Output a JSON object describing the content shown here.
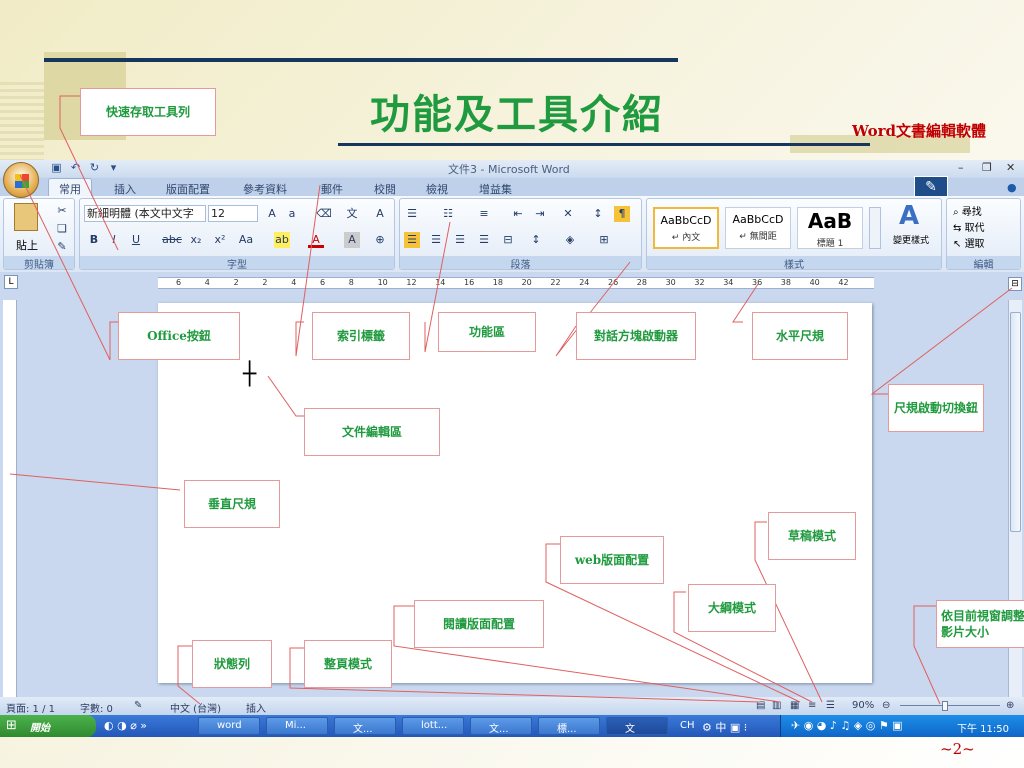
{
  "slide": {
    "title": "功能及工具介紹",
    "subtitle": "Word文書編輯軟體",
    "page_number": "~2~"
  },
  "window": {
    "title": "文件3 - Microsoft Word",
    "qat_icons": [
      "save-icon",
      "undo-icon",
      "redo-icon",
      "customize-icon"
    ]
  },
  "tabs": [
    "常用",
    "插入",
    "版面配置",
    "參考資料",
    "郵件",
    "校閱",
    "檢視",
    "增益集"
  ],
  "ribbon": {
    "clipboard": {
      "label": "剪貼簿",
      "paste": "貼上"
    },
    "font": {
      "label": "字型",
      "name": "新細明體 (本文中文字",
      "size": "12"
    },
    "paragraph": {
      "label": "段落"
    },
    "styles": {
      "label": "樣式",
      "items": [
        {
          "preview": "AaBbCcD",
          "name": "↵ 內文"
        },
        {
          "preview": "AaBbCcD",
          "name": "↵ 無間距"
        },
        {
          "preview": "AaB",
          "name": "標題 1"
        }
      ],
      "change_styles": "變更樣式"
    },
    "editing": {
      "label": "編輯",
      "find": "尋找",
      "replace": "取代",
      "select": "選取"
    }
  },
  "ruler_ticks": [
    "6",
    "4",
    "2",
    "2",
    "4",
    "6",
    "8",
    "10",
    "12",
    "14",
    "16",
    "18",
    "20",
    "22",
    "24",
    "26",
    "28",
    "30",
    "32",
    "34",
    "36",
    "38",
    "40",
    "42"
  ],
  "status": {
    "page": "頁面: 1 / 1",
    "words": "字數: 0",
    "language": "中文 (台灣)",
    "mode": "插入",
    "zoom": "90%"
  },
  "taskbar": {
    "start": "開始",
    "buttons": [
      "word",
      "Mi...",
      "文...",
      "lott...",
      "文...",
      "標...",
      "文"
    ],
    "clock": "下午 11:50",
    "ime": "CH"
  },
  "callouts": {
    "qat": "快速存取工具列",
    "office": "Office按鈕",
    "tab": "索引標籤",
    "ribbon": "功能區",
    "dialog": "對話方塊啟動器",
    "hruler": "水平尺規",
    "ruler_toggle": "尺規啟動切換鈕",
    "editarea": "文件編輯區",
    "vruler": "垂直尺規",
    "draft": "草稿模式",
    "web": "web版面配置",
    "outline": "大綱模式",
    "reading": "閱讀版面配置",
    "zoom": "依目前視窗調整影片大小",
    "status": "狀態列",
    "print": "整頁模式"
  }
}
